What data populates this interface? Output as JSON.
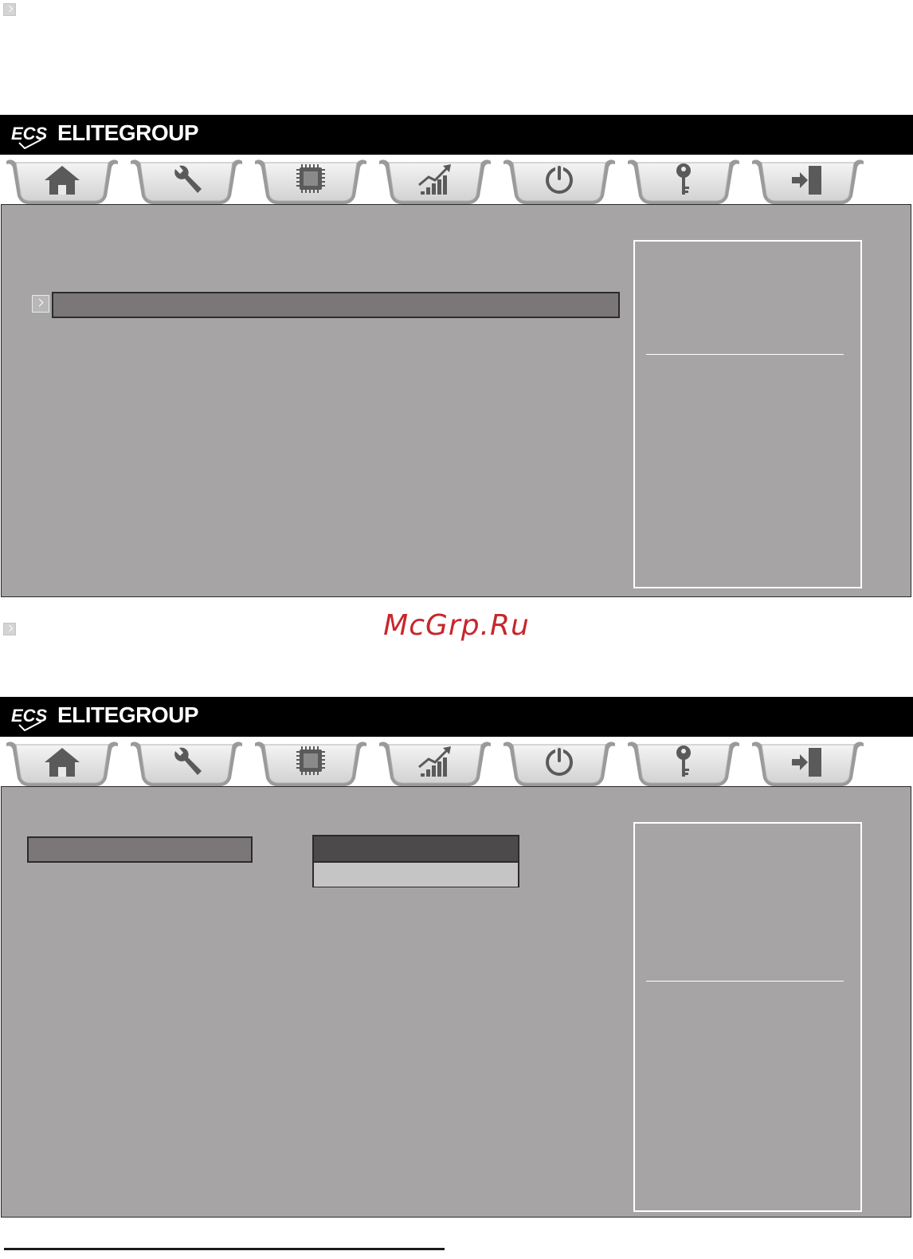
{
  "brand": {
    "name": "ELITEGROUP",
    "logo_text": "ECS"
  },
  "watermark": "McGrp.Ru",
  "colors": {
    "brand_bar": "#000000",
    "panel": "#a6a4a5",
    "highlight_row": "#7b7778",
    "watermark": "#c8262b"
  },
  "tabs": [
    {
      "icon": "home-icon"
    },
    {
      "icon": "wrench-icon"
    },
    {
      "icon": "chip-icon"
    },
    {
      "icon": "chart-icon"
    },
    {
      "icon": "power-icon"
    },
    {
      "icon": "key-icon"
    },
    {
      "icon": "exit-icon"
    }
  ],
  "screens": [
    {
      "has_selected_row": true,
      "has_popup": false
    },
    {
      "has_selected_row": true,
      "has_popup": true,
      "popup_options": 2
    }
  ]
}
